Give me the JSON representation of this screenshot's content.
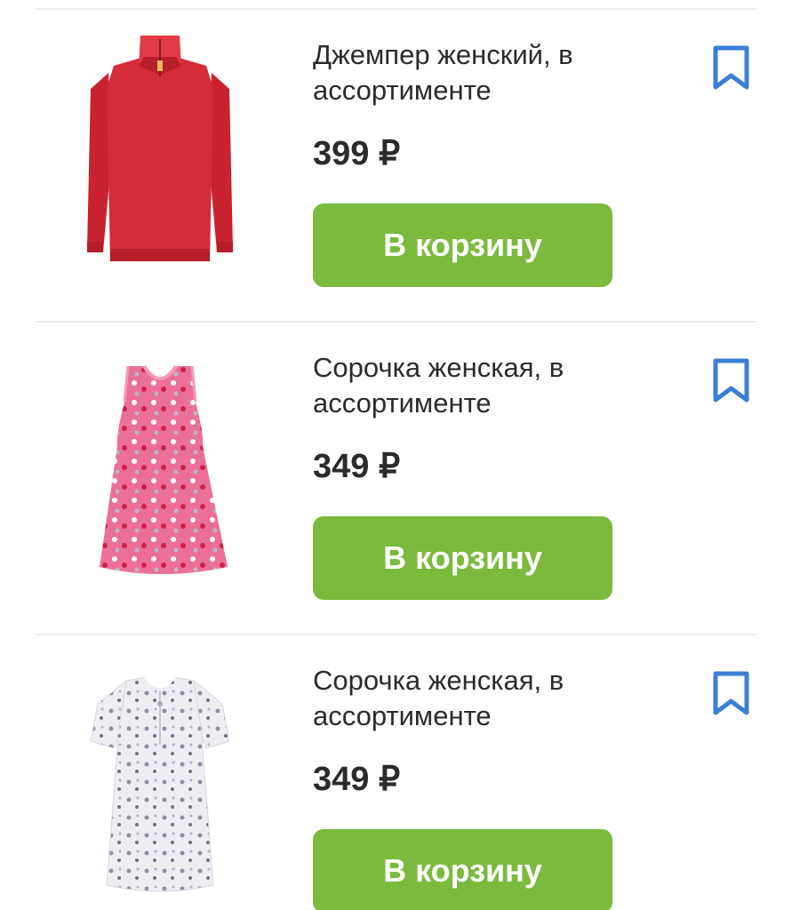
{
  "colors": {
    "accent_green": "#7aba3c",
    "bookmark_blue": "#3b7fd6",
    "text": "#2b2b2b"
  },
  "products": [
    {
      "title": "Джемпер женский, в ассортименте",
      "price": "399 ₽",
      "button_label": "В корзину",
      "image_icon": "red-sweater-image",
      "bookmark_icon": "bookmark-icon"
    },
    {
      "title": "Сорочка женская, в ассортименте",
      "price": "349 ₽",
      "button_label": "В корзину",
      "image_icon": "pink-nightgown-image",
      "bookmark_icon": "bookmark-icon"
    },
    {
      "title": "Сорочка женская, в ассортименте",
      "price": "349 ₽",
      "button_label": "В корзину",
      "image_icon": "white-nightgown-image",
      "bookmark_icon": "bookmark-icon"
    }
  ]
}
